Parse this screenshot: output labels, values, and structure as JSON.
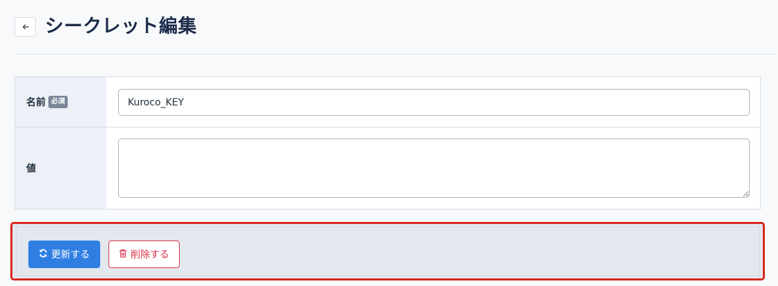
{
  "page": {
    "title": "シークレット編集"
  },
  "form": {
    "name": {
      "label": "名前",
      "required_badge": "必須",
      "value": "Kuroco_KEY"
    },
    "value": {
      "label": "値",
      "value": ""
    }
  },
  "actions": {
    "update_label": "更新する",
    "delete_label": "削除する"
  },
  "icons": {
    "back": "arrow-left-icon",
    "update": "refresh-icon",
    "delete": "trash-icon"
  },
  "colors": {
    "primary": "#2f7fe3",
    "danger": "#d9334b",
    "highlight_border": "#d9261c"
  }
}
